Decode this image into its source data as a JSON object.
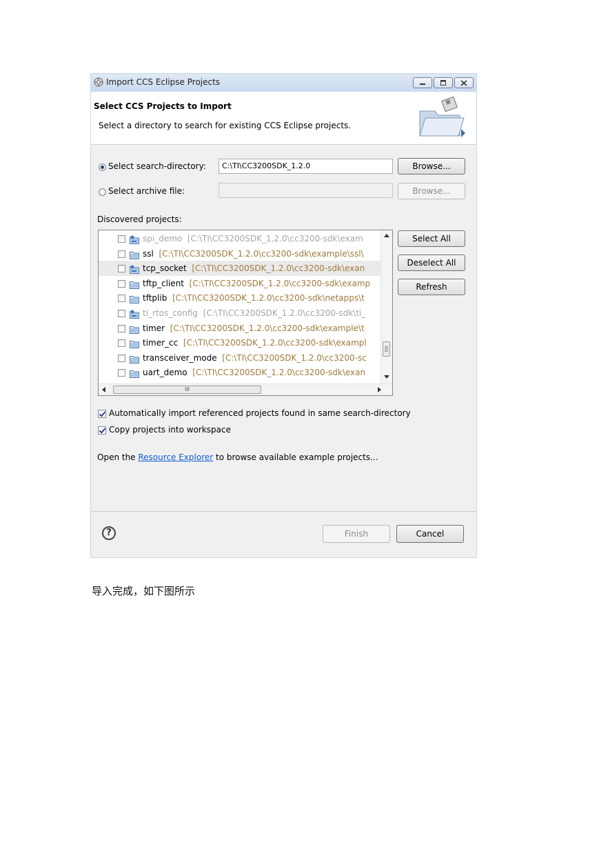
{
  "window": {
    "title": "Import CCS Eclipse Projects",
    "controls": [
      "minimize",
      "maximize",
      "close"
    ]
  },
  "header": {
    "title": "Select CCS Projects to Import",
    "description": "Select a directory to search for existing CCS Eclipse projects."
  },
  "search": {
    "directory_label": "Select search-directory:",
    "directory_value": "C:\\TI\\CC3200SDK_1.2.0",
    "directory_selected": true,
    "archive_label": "Select archive file:",
    "archive_value": "",
    "browse_label": "Browse..."
  },
  "projects": {
    "label": "Discovered projects:",
    "items": [
      {
        "name": "spi_demo",
        "path": "[C:\\TI\\CC3200SDK_1.2.0\\cc3200-sdk\\exam",
        "icon": "project-icon",
        "enabled": false
      },
      {
        "name": "ssl",
        "path": "[C:\\TI\\CC3200SDK_1.2.0\\cc3200-sdk\\example\\ssl\\",
        "icon": "folder-icon",
        "enabled": true
      },
      {
        "name": "tcp_socket",
        "path": "[C:\\TI\\CC3200SDK_1.2.0\\cc3200-sdk\\exan",
        "icon": "project-icon",
        "enabled": true,
        "selected": true
      },
      {
        "name": "tftp_client",
        "path": "[C:\\TI\\CC3200SDK_1.2.0\\cc3200-sdk\\examp",
        "icon": "folder-icon",
        "enabled": true
      },
      {
        "name": "tftplib",
        "path": "[C:\\TI\\CC3200SDK_1.2.0\\cc3200-sdk\\netapps\\t",
        "icon": "folder-icon",
        "enabled": true
      },
      {
        "name": "ti_rtos_config",
        "path": "[C:\\TI\\CC3200SDK_1.2.0\\cc3200-sdk\\ti_",
        "icon": "project-icon",
        "enabled": false
      },
      {
        "name": "timer",
        "path": "[C:\\TI\\CC3200SDK_1.2.0\\cc3200-sdk\\example\\t",
        "icon": "folder-icon",
        "enabled": true
      },
      {
        "name": "timer_cc",
        "path": "[C:\\TI\\CC3200SDK_1.2.0\\cc3200-sdk\\exampl",
        "icon": "folder-icon",
        "enabled": true
      },
      {
        "name": "transceiver_mode",
        "path": "[C:\\TI\\CC3200SDK_1.2.0\\cc3200-sc",
        "icon": "folder-icon",
        "enabled": true
      },
      {
        "name": "uart_demo",
        "path": "[C:\\TI\\CC3200SDK_1.2.0\\cc3200-sdk\\exan",
        "icon": "folder-icon",
        "enabled": true
      }
    ],
    "hscroll_thumb_label": "III",
    "select_all": "Select All",
    "deselect_all": "Deselect All",
    "refresh": "Refresh"
  },
  "options": {
    "auto_import_label": "Automatically import referenced projects found in same search-directory",
    "auto_import_checked": true,
    "copy_label": "Copy projects into workspace",
    "copy_checked": true
  },
  "resource": {
    "prefix": "Open the ",
    "link": "Resource Explorer",
    "suffix": " to browse available example projects..."
  },
  "footer": {
    "help": "?",
    "finish": "Finish",
    "cancel": "Cancel"
  },
  "caption": "导入完成，如下图所示",
  "colors": {
    "path_text": "#a07a3c",
    "disabled_text": "#a5a5a5",
    "link": "#0b5bd3",
    "titlebar": "#c9daef"
  }
}
